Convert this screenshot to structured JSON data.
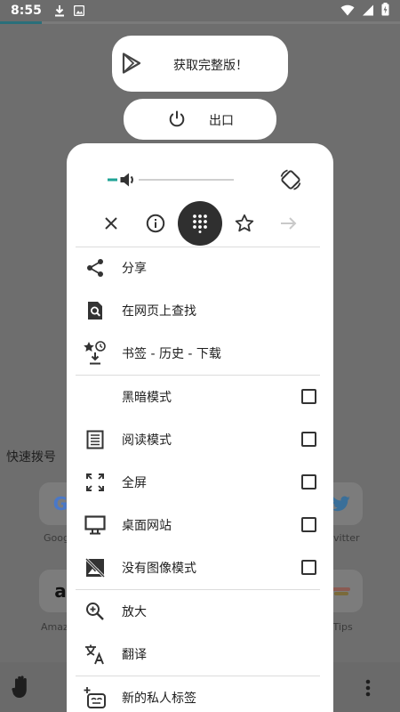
{
  "status_bar": {
    "time": "8:55",
    "left_icons": [
      "download-icon",
      "photo-icon"
    ],
    "right_icons": [
      "wifi-icon",
      "signal-icon",
      "battery-icon"
    ]
  },
  "page_progress": 0.105,
  "colors": {
    "accent": "#1fa396",
    "dim_overlay": "#6e6e6e",
    "panel": "#ffffff"
  },
  "promo": {
    "get_full_label": "获取完整版！",
    "exit_label": "出口"
  },
  "menu": {
    "volume_level": 0.15,
    "nav_buttons": [
      {
        "name": "close-icon"
      },
      {
        "name": "info-icon"
      },
      {
        "name": "dialpad-icon",
        "active": true
      },
      {
        "name": "star-icon"
      },
      {
        "name": "arrow-right-icon",
        "disabled": true
      }
    ],
    "items": [
      {
        "label": "分享",
        "icon": "share-icon"
      },
      {
        "label": "在网页上查找",
        "icon": "find-in-page-icon"
      },
      {
        "label": "书签 - 历史 - 下载",
        "icon": "bookmarks-history-download-icon"
      },
      {
        "label": "黑暗模式",
        "icon": "moon-icon",
        "checkbox": false
      },
      {
        "label": "阅读模式",
        "icon": "reader-icon",
        "checkbox": false
      },
      {
        "label": "全屏",
        "icon": "fullscreen-icon",
        "checkbox": false
      },
      {
        "label": "桌面网站",
        "icon": "desktop-icon",
        "checkbox": false
      },
      {
        "label": "没有图像模式",
        "icon": "no-image-icon",
        "checkbox": false
      },
      {
        "label": "放大",
        "icon": "zoom-in-icon"
      },
      {
        "label": "翻译",
        "icon": "translate-icon"
      },
      {
        "label": "新的私人标签",
        "icon": "private-tab-icon"
      }
    ]
  },
  "speed_dial": {
    "title": "快速拨号",
    "tiles": [
      {
        "glyph": "G",
        "label": "Goog"
      },
      {
        "glyph": "a",
        "label": "Amaz"
      },
      {
        "glyph": "tw",
        "label": "vitter"
      },
      {
        "glyph": "",
        "label": "l Tips"
      }
    ]
  }
}
